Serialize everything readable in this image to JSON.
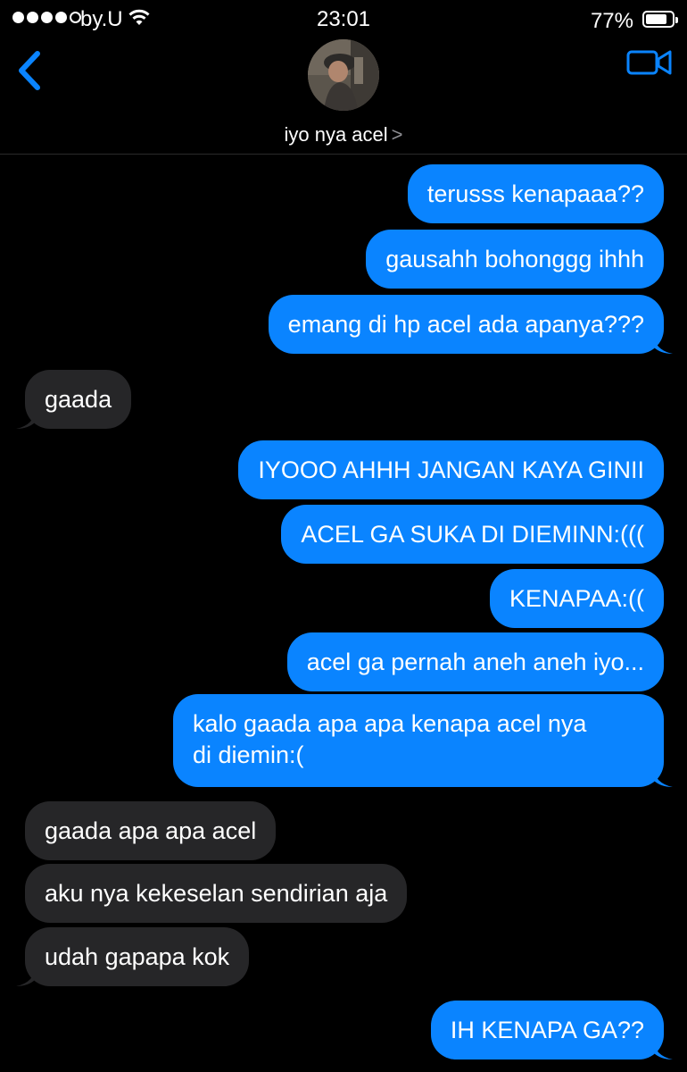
{
  "status_bar": {
    "carrier": "by.U",
    "time": "23:01",
    "battery_percent": "77%",
    "signal_bars_filled": 4,
    "signal_bars_total": 5
  },
  "header": {
    "back_icon": "chevron-left-icon",
    "video_icon": "video-camera-icon",
    "contact_name": "iyo nya acel",
    "contact_chevron": ">"
  },
  "colors": {
    "accent": "#0a84ff",
    "outgoing_bubble": "#0a84ff",
    "incoming_bubble": "#262628",
    "background": "#000000"
  },
  "messages": [
    {
      "direction": "outgoing",
      "text": "terusss kenapaaa??"
    },
    {
      "direction": "outgoing",
      "text": "gausahh bohonggg ihhh"
    },
    {
      "direction": "outgoing",
      "text": "emang di hp acel ada apanya???"
    },
    {
      "direction": "incoming",
      "text": "gaada"
    },
    {
      "direction": "outgoing",
      "text": "IYOOO AHHH JANGAN KAYA GINII"
    },
    {
      "direction": "outgoing",
      "text": "ACEL GA SUKA DI DIEMINN:((("
    },
    {
      "direction": "outgoing",
      "text": "KENAPAA:(("
    },
    {
      "direction": "outgoing",
      "text": "acel ga pernah aneh aneh iyo..."
    },
    {
      "direction": "outgoing",
      "text": "kalo gaada apa apa kenapa acel nya",
      "text_line2": "di diemin:("
    },
    {
      "direction": "incoming",
      "text": "gaada apa apa acel"
    },
    {
      "direction": "incoming",
      "text": "aku nya kekeselan sendirian aja"
    },
    {
      "direction": "incoming",
      "text": "udah gapapa kok"
    },
    {
      "direction": "outgoing",
      "text": "IH KENAPA GA??"
    }
  ]
}
